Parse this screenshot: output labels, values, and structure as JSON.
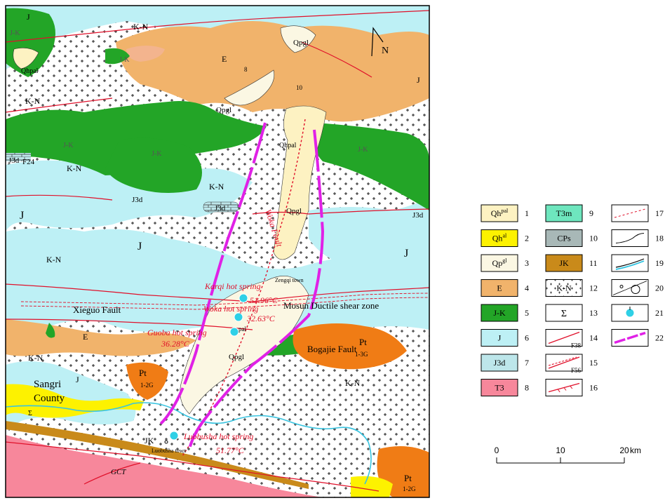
{
  "colors": {
    "qhpal": "#fdf2c2",
    "qhal": "#fdf200",
    "qpgl": "#fbf7e3",
    "e": "#f1b36b",
    "jk": "#23a527",
    "j": "#bdf0f5",
    "j3d": "#bde6ea",
    "t3": "#f7879b",
    "t3m": "#6ee6be",
    "cps": "#a8b8b7",
    "jk_unit": "#c98a1a",
    "kn": "#ffffff",
    "pt": "#f07c15",
    "fault": "#e0102a",
    "magenta": "#e021e6",
    "river": "#38c4e0",
    "spring": "#2fd0e6"
  },
  "map_labels": {
    "j_nw": "J",
    "jk_nw": "J-K",
    "kn_top": "K-N",
    "jk_top": "J-K",
    "e_top": "E",
    "dip_8": "8",
    "dip_10": "10",
    "qpgl_top": "Qpgl",
    "qpgl_mid": "Qpgl",
    "n_top": "N",
    "j_ne": "J",
    "qhpal_nw": "Qhpal",
    "kn_west": "K-N",
    "jk_west": "J-K",
    "jk_center": "J-K",
    "j3d_west": "J3d",
    "f24": "F24",
    "kn_center_w": "K-N",
    "kn_center": "K-N",
    "j3d_center": "J3d",
    "j3d_small": "J3d",
    "j3d_east": "J3d",
    "qhpal_valley": "Qhpal",
    "jk_east": "J-K",
    "qpgl_valley": "Qpgl",
    "woka_fault": "Woka Fault",
    "j_west": "J",
    "j_center": "J",
    "j_east": "J",
    "kn_lower_w": "K-N",
    "xieguo_fault": "Xieguo Fault",
    "e_low": "E",
    "zengqi_town": "Zengqi town",
    "mosun_zone": "Mosun Ductile shear zone",
    "pal_label": "pal",
    "qpgl_low": "Qpgl",
    "bogajie_fault": "Bogajie Fault",
    "pt_east": "Pt",
    "pt_east_sub": "1-3G",
    "kn_sw": "K-N",
    "j_sw": "J",
    "pt_center": "Pt",
    "pt_center_sub": "1-2G",
    "kn_se": "K-N",
    "sangri": "Sangri",
    "county": "County",
    "sigma_sw": "Σ",
    "jk_south": "JK",
    "luobusha_town": "Luobusha town",
    "gct": "GCT",
    "pt_se": "Pt",
    "pt_se_sub": "1-2G"
  },
  "hot_springs": [
    {
      "name": "Karqi hot spring",
      "temp": "51.96°C"
    },
    {
      "name": "Woka hot spring",
      "temp": "32.63°C"
    },
    {
      "name": "Guoba hot spring",
      "temp": "36.28°C"
    },
    {
      "name": "Luobusha hot spring",
      "temp": "51.77°C"
    }
  ],
  "legend": {
    "items": [
      {
        "num": "1",
        "label": "Qh",
        "sup": "pal",
        "type": "fill",
        "color": "#fdf2c2"
      },
      {
        "num": "2",
        "label": "Qh",
        "sup": "al",
        "type": "fill",
        "color": "#fdf200"
      },
      {
        "num": "3",
        "label": "Qp",
        "sup": "gl",
        "type": "fill",
        "color": "#fbf7e3"
      },
      {
        "num": "4",
        "label": "E",
        "sup": "",
        "type": "fill",
        "color": "#f1b36b"
      },
      {
        "num": "5",
        "label": "J-K",
        "sup": "",
        "type": "fill",
        "color": "#23a527"
      },
      {
        "num": "6",
        "label": "J",
        "sup": "",
        "type": "fill",
        "color": "#bdf0f5"
      },
      {
        "num": "7",
        "label": "J3d",
        "sup": "",
        "type": "fill",
        "color": "#bde6ea"
      },
      {
        "num": "8",
        "label": "T3",
        "sup": "",
        "type": "fill",
        "color": "#f7879b"
      },
      {
        "num": "9",
        "label": "T3m",
        "sup": "",
        "type": "fill",
        "color": "#6ee6be"
      },
      {
        "num": "10",
        "label": "CPs",
        "sup": "",
        "type": "fill",
        "color": "#a8b8b7"
      },
      {
        "num": "11",
        "label": "JK",
        "sup": "",
        "type": "fill",
        "color": "#c98a1a"
      },
      {
        "num": "12",
        "label": "K-N",
        "sup": "",
        "type": "fill",
        "color": "#ffffff"
      },
      {
        "num": "13",
        "label": "Σ",
        "sup": "",
        "type": "sigma",
        "color": "#ffffff"
      },
      {
        "num": "14",
        "label": "F38",
        "sup": "",
        "type": "fault",
        "color": "#e0102a"
      },
      {
        "num": "15",
        "label": "F56",
        "sup": "",
        "type": "fault-double",
        "color": "#e0102a"
      },
      {
        "num": "16",
        "label": "",
        "sup": "",
        "type": "thrust",
        "color": "#e0102a"
      },
      {
        "num": "17",
        "label": "",
        "sup": "",
        "type": "inferred",
        "color": "#e0102a"
      },
      {
        "num": "18",
        "label": "",
        "sup": "",
        "type": "contact",
        "color": "#000000"
      },
      {
        "num": "19",
        "label": "",
        "sup": "",
        "type": "river",
        "color": "#38c4e0"
      },
      {
        "num": "20",
        "label": "",
        "sup": "",
        "type": "town",
        "color": "#000000"
      },
      {
        "num": "21",
        "label": "",
        "sup": "",
        "type": "spring",
        "color": "#2fd0e6"
      },
      {
        "num": "22",
        "label": "",
        "sup": "",
        "type": "magenta",
        "color": "#e021e6"
      }
    ]
  },
  "scale": {
    "ticks": [
      "0",
      "10",
      "20"
    ],
    "unit": "km"
  }
}
